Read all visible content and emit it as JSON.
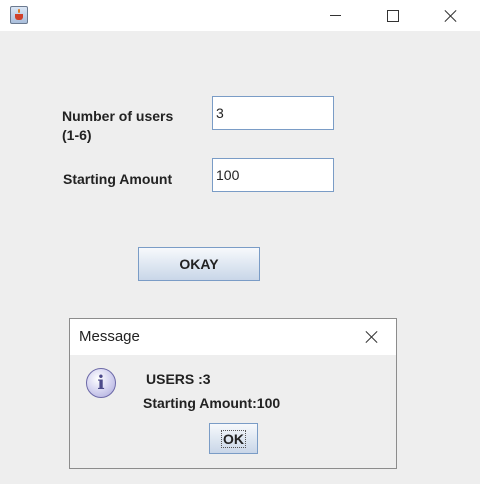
{
  "window": {
    "title": "",
    "icon": "java-cup-icon"
  },
  "form": {
    "users_label": "Number of users\n(1-6)",
    "users_value": "3",
    "amount_label": "Starting Amount",
    "amount_value": "100",
    "okay_label": "OKAY"
  },
  "dialog": {
    "title": "Message",
    "icon": "info-icon",
    "line1": "USERS :3",
    "line2": "Starting Amount:100",
    "ok_label": "OK"
  },
  "colors": {
    "window_bg": "#eeeeee",
    "titlebar_bg": "#ffffff",
    "field_border": "#7a9cc6",
    "button_gradient_top": "#f7f9fc",
    "button_gradient_bottom": "#c9d6e8"
  }
}
